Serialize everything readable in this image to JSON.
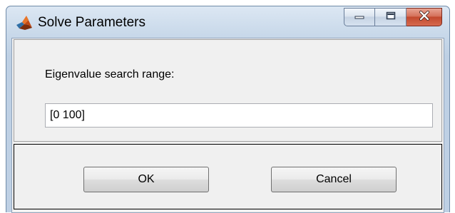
{
  "window": {
    "title": "Solve Parameters",
    "app_icon": "matlab-logo-icon",
    "caption_buttons": [
      "minimize-icon",
      "maximize-icon",
      "close-icon"
    ]
  },
  "form": {
    "label": "Eigenvalue search range:",
    "value": "[0 100]"
  },
  "buttons": {
    "ok_label": "OK",
    "cancel_label": "Cancel"
  },
  "colors": {
    "close_button": "#c2492e",
    "client_background": "#f0f0f0",
    "frame": "#c9d9ea"
  }
}
